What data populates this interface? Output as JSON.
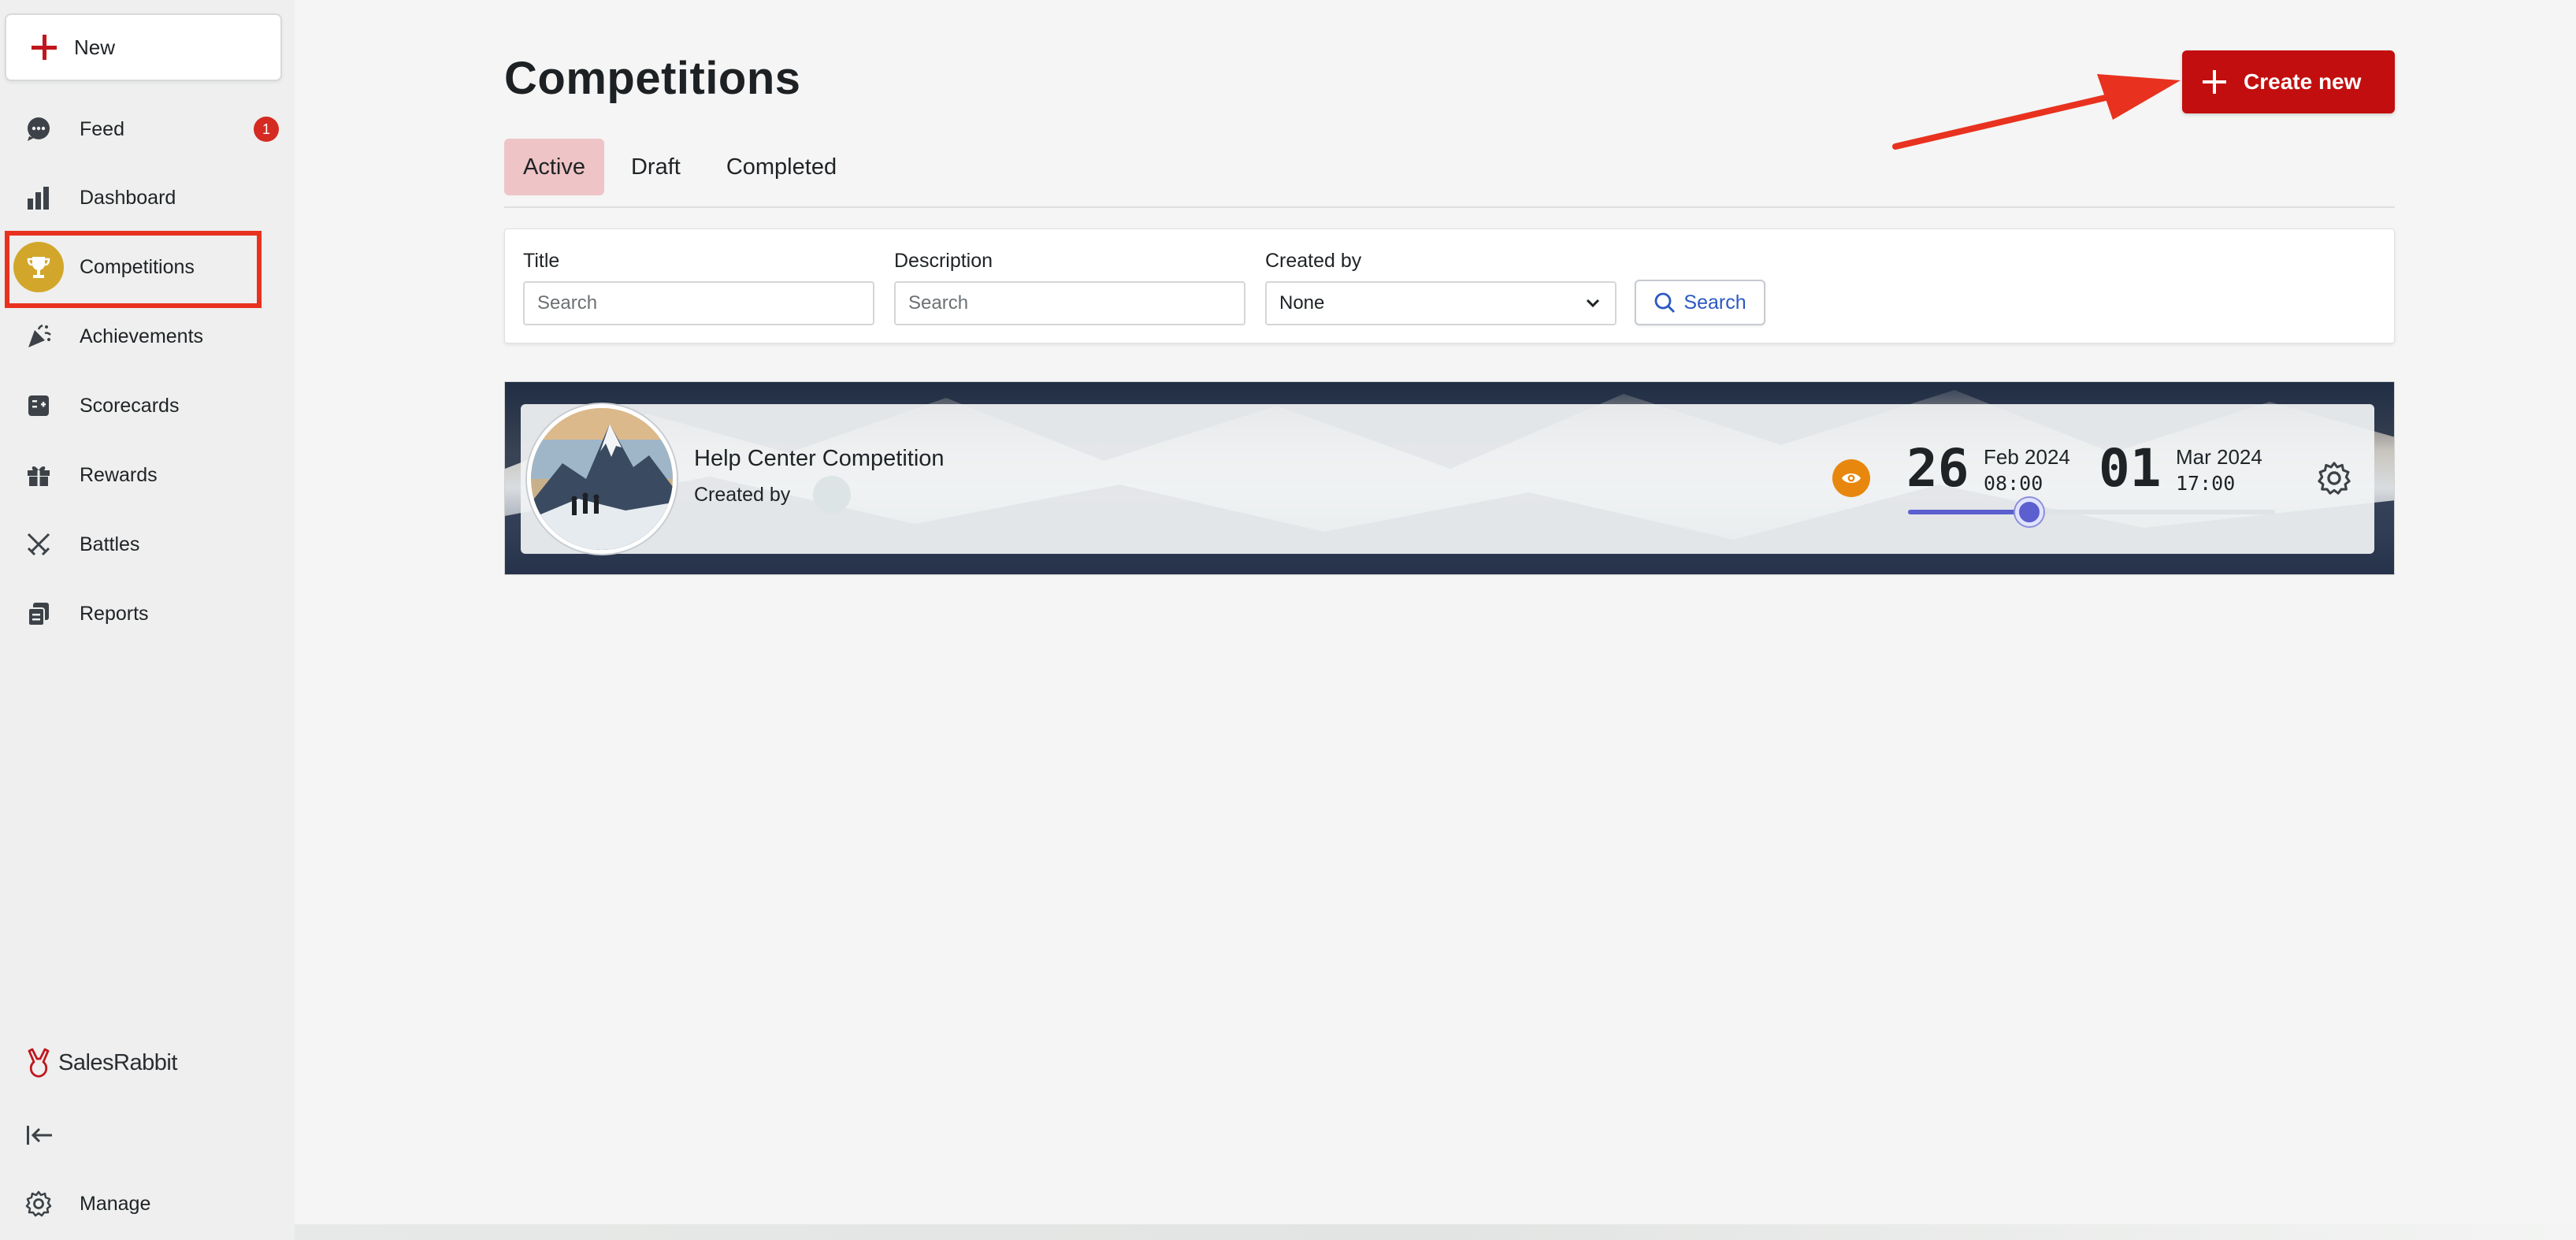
{
  "sidebar": {
    "new_label": "New",
    "items": [
      {
        "label": "Feed",
        "icon": "chat-bubble-icon",
        "badge": "1"
      },
      {
        "label": "Dashboard",
        "icon": "bar-chart-icon"
      },
      {
        "label": "Competitions",
        "icon": "trophy-icon",
        "active": true
      },
      {
        "label": "Achievements",
        "icon": "party-popper-icon"
      },
      {
        "label": "Scorecards",
        "icon": "scorecard-icon"
      },
      {
        "label": "Rewards",
        "icon": "gift-icon"
      },
      {
        "label": "Battles",
        "icon": "crossed-swords-icon"
      },
      {
        "label": "Reports",
        "icon": "reports-icon"
      }
    ],
    "brand": "SalesRabbit",
    "manage_label": "Manage"
  },
  "header": {
    "title": "Competitions",
    "create_label": "Create new"
  },
  "tabs": [
    {
      "label": "Active",
      "active": true
    },
    {
      "label": "Draft"
    },
    {
      "label": "Completed"
    }
  ],
  "filters": {
    "title_label": "Title",
    "title_placeholder": "Search",
    "description_label": "Description",
    "description_placeholder": "Search",
    "created_by_label": "Created by",
    "created_by_value": "None",
    "search_label": "Search"
  },
  "competition": {
    "title": "Help Center Competition",
    "created_by_label": "Created by",
    "start_day": "26",
    "start_month": "Feb 2024",
    "start_time": "08:00",
    "end_day": "01",
    "end_month": "Mar 2024",
    "end_time": "17:00",
    "progress": 0.33
  },
  "colors": {
    "brand_red": "#c20e0e",
    "active_tab": "#eec4c6",
    "active_icon": "#d2a62b",
    "badge": "#d42a22",
    "annotation": "#e8321f",
    "progress": "#5b5fcf",
    "eye_badge": "#e8870e"
  }
}
